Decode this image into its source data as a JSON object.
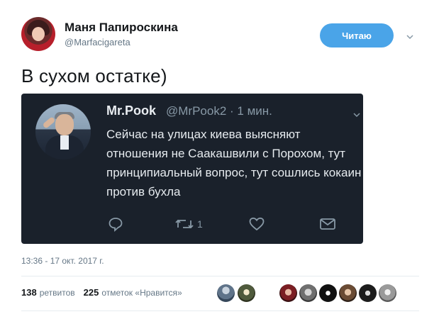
{
  "author": {
    "name": "Маня Папироскина",
    "handle": "@Marfacigareta"
  },
  "follow_button": {
    "label": "Читаю"
  },
  "tweet": {
    "text": "В сухом остатке)"
  },
  "quoted_tweet": {
    "name": "Mr.Pook",
    "handle_time": "@MrPook2 · 1 мин.",
    "text": "Сейчас на улицах киева выясняют отношения не Саакашвили с Порохом, тут принципиальный вопрос, тут сошлись кокаин против бухла",
    "retweet_count": "1"
  },
  "timestamp": "13:36 - 17 окт. 2017 г.",
  "stats": {
    "retweets_count": "138",
    "retweets_label": "ретвитов",
    "likes_count": "225",
    "likes_label": "отметок «Нравится»"
  },
  "icons": {
    "more": "chevron-down-icon",
    "reply": "reply-icon",
    "retweet": "retweet-icon",
    "like": "heart-icon",
    "dm": "envelope-icon"
  },
  "colors": {
    "accent": "#4aa4e8",
    "quote_bg": "#1a212b",
    "muted": "#657786"
  }
}
